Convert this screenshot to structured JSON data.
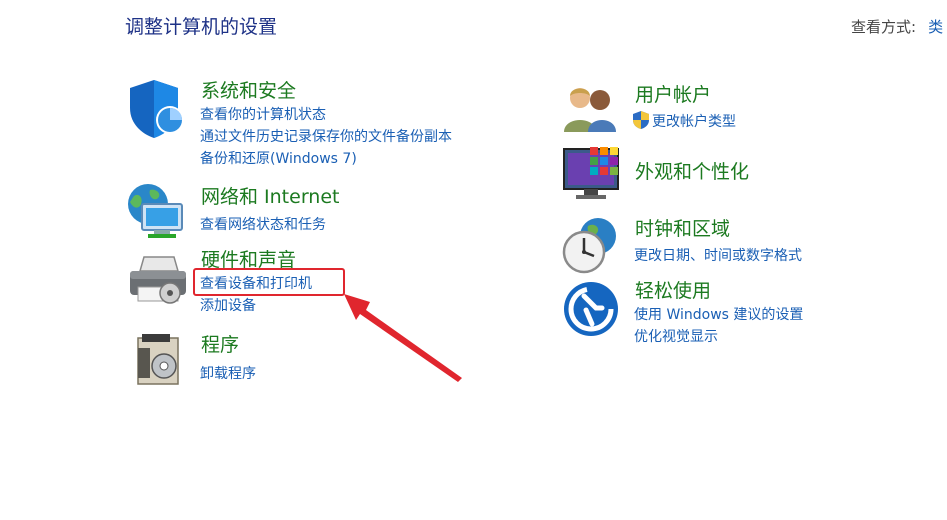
{
  "header": {
    "title": "调整计算机的设置",
    "view_by_label": "查看方式:",
    "view_by_value": "类"
  },
  "left_categories": [
    {
      "title": "系统和安全",
      "links": [
        "查看你的计算机状态",
        "通过文件历史记录保存你的文件备份副本",
        "备份和还原(Windows 7)"
      ]
    },
    {
      "title": "网络和 Internet",
      "links": [
        "查看网络状态和任务"
      ]
    },
    {
      "title": "硬件和声音",
      "links": [
        "查看设备和打印机",
        "添加设备"
      ]
    },
    {
      "title": "程序",
      "links": [
        "卸载程序"
      ]
    }
  ],
  "right_categories": [
    {
      "title": "用户帐户",
      "links": [
        "更改帐户类型"
      ]
    },
    {
      "title": "外观和个性化",
      "links": []
    },
    {
      "title": "时钟和区域",
      "links": [
        "更改日期、时间或数字格式"
      ]
    },
    {
      "title": "轻松使用",
      "links": [
        "使用 Windows 建议的设置",
        "优化视觉显示"
      ]
    }
  ],
  "icons": {
    "system_security": "shield-icon",
    "network": "globe-network-icon",
    "hardware": "printer-icon",
    "programs": "program-disc-icon",
    "user_accounts": "users-icon",
    "appearance": "monitor-tiles-icon",
    "clock_region": "clock-globe-icon",
    "ease_of_access": "accessibility-icon",
    "uac": "uac-shield-icon"
  },
  "colors": {
    "title_blue": "#1e3287",
    "category_green": "#1c7a20",
    "link_blue": "#1a5fb4",
    "annotation_red": "#e0262e"
  }
}
